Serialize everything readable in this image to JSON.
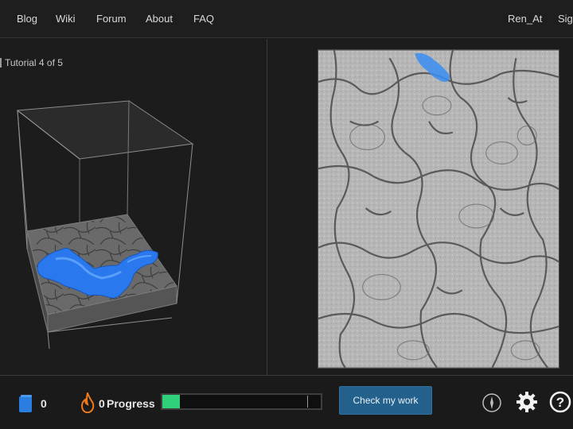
{
  "nav": {
    "links": [
      "Blog",
      "Wiki",
      "Forum",
      "About",
      "FAQ"
    ],
    "user": "Ren_At",
    "sign": "Sign"
  },
  "tutorial": {
    "label": "Tutorial 4 of 5"
  },
  "bottom": {
    "cube_count": "0",
    "flame_count": "0",
    "progress_label": "Progress",
    "progress_fraction": 0.11,
    "check_button": "Check my work"
  },
  "icons": {
    "cube": "cube-icon",
    "flame": "flame-icon",
    "compass": "compass-icon",
    "settings": "gear-icon",
    "help": "help-icon"
  },
  "colors": {
    "accent_blue": "#24608c",
    "progress_green": "#2fd07a",
    "segment_blue": "#2a7cf0",
    "flame_orange": "#f07a1a"
  }
}
